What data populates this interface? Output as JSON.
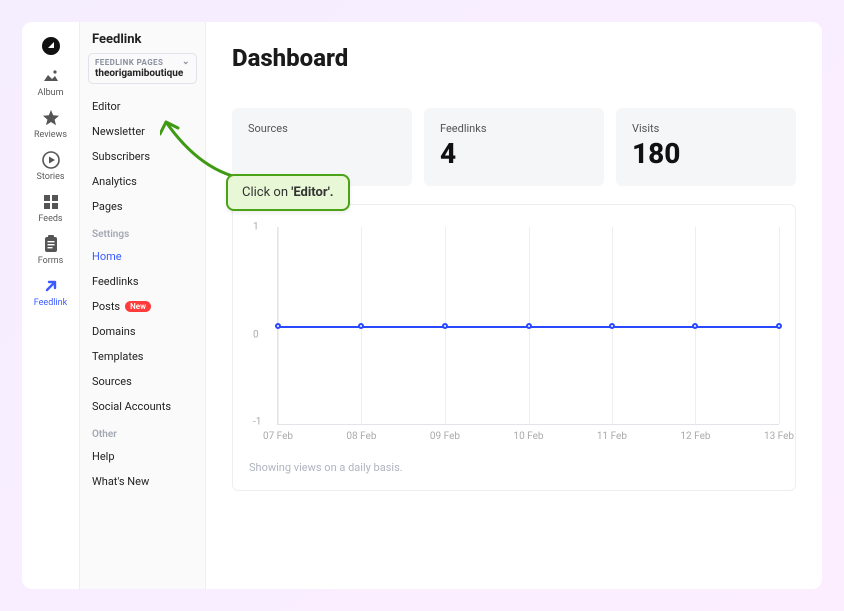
{
  "rail": [
    {
      "id": "logo",
      "label": ""
    },
    {
      "id": "album",
      "label": "Album"
    },
    {
      "id": "reviews",
      "label": "Reviews"
    },
    {
      "id": "stories",
      "label": "Stories"
    },
    {
      "id": "feeds",
      "label": "Feeds"
    },
    {
      "id": "forms",
      "label": "Forms"
    },
    {
      "id": "feedlink",
      "label": "Feedlink"
    }
  ],
  "sidebar": {
    "title": "Feedlink",
    "selector": {
      "label": "FEEDLINK PAGES",
      "value": "theorigamiboutique"
    },
    "nav1": [
      {
        "label": "Editor"
      },
      {
        "label": "Newsletter"
      },
      {
        "label": "Subscribers"
      },
      {
        "label": "Analytics"
      },
      {
        "label": "Pages"
      }
    ],
    "section_settings": "Settings",
    "nav2": [
      {
        "label": "Home",
        "active": true
      },
      {
        "label": "Feedlinks"
      },
      {
        "label": "Posts",
        "badge": "New"
      },
      {
        "label": "Domains"
      },
      {
        "label": "Templates"
      },
      {
        "label": "Sources"
      },
      {
        "label": "Social Accounts"
      }
    ],
    "section_other": "Other",
    "nav3": [
      {
        "label": "Help"
      },
      {
        "label": "What's New"
      }
    ]
  },
  "page": {
    "title": "Dashboard"
  },
  "stats": [
    {
      "label": "Sources",
      "value": ""
    },
    {
      "label": "Feedlinks",
      "value": "4"
    },
    {
      "label": "Visits",
      "value": "180"
    }
  ],
  "chart_data": {
    "type": "line",
    "categories": [
      "07 Feb",
      "08 Feb",
      "09 Feb",
      "10 Feb",
      "11 Feb",
      "12 Feb",
      "13 Feb"
    ],
    "values": [
      0,
      0,
      0,
      0,
      0,
      0,
      0
    ],
    "ylim": [
      -1,
      1
    ],
    "yticks": [
      1,
      0,
      -1
    ],
    "caption": "Showing views on a daily basis."
  },
  "callout": {
    "prefix": "Click on ",
    "target": "'Editor'."
  }
}
